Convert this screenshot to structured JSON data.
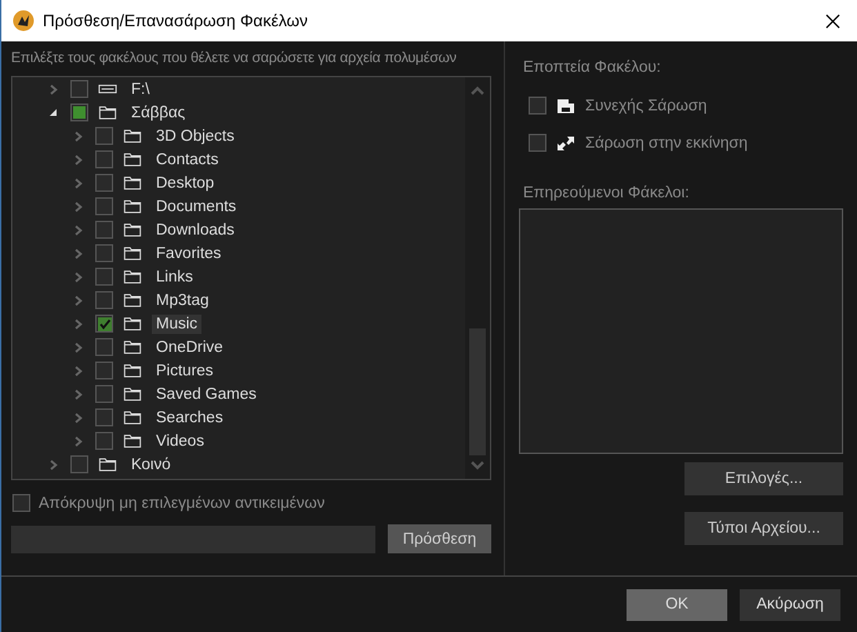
{
  "window": {
    "title": "Πρόσθεση/Επανασάρωση Φακέλων"
  },
  "instruction": "Επιλέξτε τους φακέλους που θέλετε να σαρώσετε για αρχεία πολυμέσων",
  "tree": {
    "items": [
      {
        "label": "F:\\",
        "kind": "drive",
        "checked": false,
        "partial": false,
        "expanded": false,
        "selected": false
      },
      {
        "label": "Σάββας",
        "kind": "folder",
        "checked": false,
        "partial": true,
        "expanded": true,
        "selected": false,
        "children": [
          {
            "label": "3D Objects",
            "kind": "folder",
            "checked": false,
            "partial": false,
            "expanded": false,
            "selected": false
          },
          {
            "label": "Contacts",
            "kind": "folder",
            "checked": false,
            "partial": false,
            "expanded": false,
            "selected": false
          },
          {
            "label": "Desktop",
            "kind": "folder",
            "checked": false,
            "partial": false,
            "expanded": false,
            "selected": false
          },
          {
            "label": "Documents",
            "kind": "folder",
            "checked": false,
            "partial": false,
            "expanded": false,
            "selected": false
          },
          {
            "label": "Downloads",
            "kind": "folder",
            "checked": false,
            "partial": false,
            "expanded": false,
            "selected": false
          },
          {
            "label": "Favorites",
            "kind": "folder",
            "checked": false,
            "partial": false,
            "expanded": false,
            "selected": false
          },
          {
            "label": "Links",
            "kind": "folder",
            "checked": false,
            "partial": false,
            "expanded": false,
            "selected": false
          },
          {
            "label": "Mp3tag",
            "kind": "folder",
            "checked": false,
            "partial": false,
            "expanded": false,
            "selected": false
          },
          {
            "label": "Music",
            "kind": "folder",
            "checked": true,
            "partial": false,
            "expanded": false,
            "selected": true
          },
          {
            "label": "OneDrive",
            "kind": "folder",
            "checked": false,
            "partial": false,
            "expanded": false,
            "selected": false
          },
          {
            "label": "Pictures",
            "kind": "folder",
            "checked": false,
            "partial": false,
            "expanded": false,
            "selected": false
          },
          {
            "label": "Saved Games",
            "kind": "folder",
            "checked": false,
            "partial": false,
            "expanded": false,
            "selected": false
          },
          {
            "label": "Searches",
            "kind": "folder",
            "checked": false,
            "partial": false,
            "expanded": false,
            "selected": false
          },
          {
            "label": "Videos",
            "kind": "folder",
            "checked": false,
            "partial": false,
            "expanded": false,
            "selected": false
          }
        ]
      },
      {
        "label": "Κοινό",
        "kind": "folder",
        "checked": false,
        "partial": false,
        "expanded": false,
        "selected": false
      }
    ]
  },
  "hide_unselected": {
    "label": "Απόκρυψη  μη επιλεγμένων αντικειμένων",
    "checked": false
  },
  "add_button": "Πρόσθεση",
  "monitoring": {
    "heading": "Εποπτεία Φακέλου:",
    "options": [
      {
        "label": "Συνεχής Σάρωση",
        "kind": "continuous",
        "checked": false
      },
      {
        "label": "Σάρωση στην εκκίνηση",
        "kind": "startup",
        "checked": false
      }
    ]
  },
  "affected": {
    "heading": "Επηρεούμενοι Φάκελοι:"
  },
  "side_buttons": [
    "Επιλογές...",
    "Τύποι Αρχείου..."
  ],
  "footer_buttons": [
    {
      "label": "OK",
      "kind": "default"
    },
    {
      "label": "Ακύρωση",
      "kind": "normal"
    }
  ]
}
